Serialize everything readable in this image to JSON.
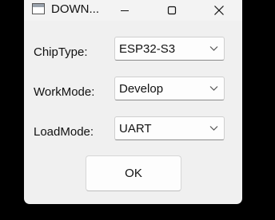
{
  "window": {
    "title": "DOWN..."
  },
  "form": {
    "chip_type": {
      "label": "ChipType:",
      "value": "ESP32-S3"
    },
    "work_mode": {
      "label": "WorkMode:",
      "value": "Develop"
    },
    "load_mode": {
      "label": "LoadMode:",
      "value": "UART"
    }
  },
  "buttons": {
    "ok_label": "OK"
  },
  "icons": {
    "app": "app-window-icon",
    "minimize": "minimize-icon",
    "maximize": "maximize-icon",
    "close": "close-icon",
    "dropdown": "chevron-down-icon"
  },
  "colors": {
    "window_bg": "#f0f0f0",
    "desktop_bg": "#000000",
    "control_bg": "#fdfdfd"
  }
}
